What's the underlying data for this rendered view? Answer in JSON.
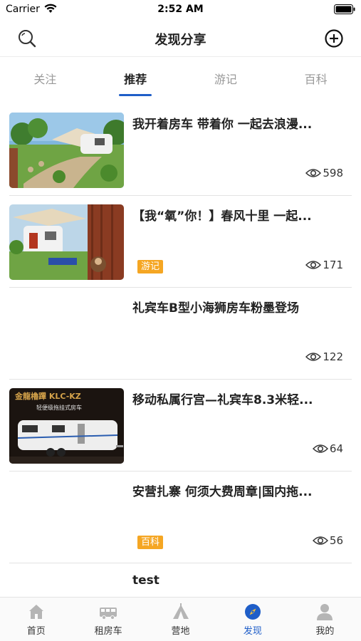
{
  "status_bar": {
    "carrier": "Carrier",
    "time": "2:52 AM"
  },
  "header": {
    "title": "发现分享",
    "search_icon": "search-icon",
    "add_icon": "add-circle-icon"
  },
  "tabs": [
    {
      "label": "关注",
      "active": false
    },
    {
      "label": "推荐",
      "active": true
    },
    {
      "label": "游记",
      "active": false
    },
    {
      "label": "百科",
      "active": false
    }
  ],
  "feed": [
    {
      "title": "我开着房车 带着你 一起去浪漫...",
      "views": "598",
      "tag": "",
      "has_image": true
    },
    {
      "title": "【我“氧”你！】春风十里 一起...",
      "views": "171",
      "tag": "游记",
      "has_image": true
    },
    {
      "title": "礼宾车B型小海狮房车粉墨登场",
      "views": "122",
      "tag": "",
      "has_image": false
    },
    {
      "title": "移动私属行宫—礼宾车8.3米轻...",
      "views": "64",
      "tag": "",
      "has_image": true,
      "image_text": "金龍櫓蹕 KLC-KZ",
      "image_subtext": "轻便级拖挂式房车"
    },
    {
      "title": "安营扎寨 何须大费周章|国内拖...",
      "views": "56",
      "tag": "百科",
      "has_image": false
    },
    {
      "title": "test"
    }
  ],
  "tab_bar": [
    {
      "label": "首页",
      "icon": "home-icon",
      "active": false
    },
    {
      "label": "租房车",
      "icon": "rv-icon",
      "active": false
    },
    {
      "label": "营地",
      "icon": "camp-icon",
      "active": false
    },
    {
      "label": "发现",
      "icon": "compass-icon",
      "active": true
    },
    {
      "label": "我的",
      "icon": "user-icon",
      "active": false
    }
  ],
  "colors": {
    "accent": "#1f5ec8",
    "tag": "#f5a623"
  }
}
